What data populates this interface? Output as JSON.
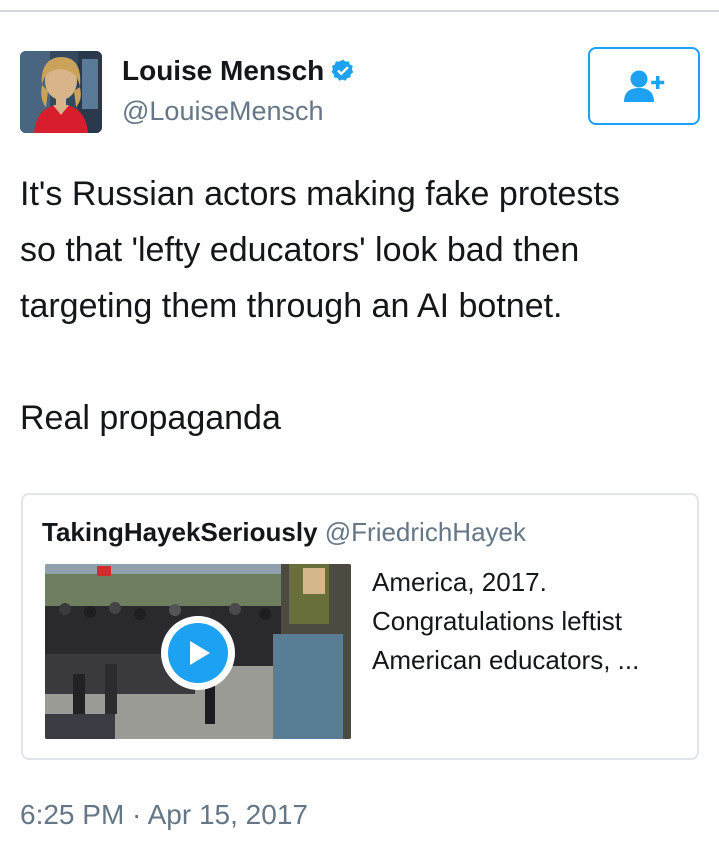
{
  "author": {
    "display_name": "Louise Mensch",
    "handle": "@LouiseMensch",
    "verified": true,
    "avatar_icon": "profile-photo"
  },
  "follow_button": {
    "icon": "add-user-icon",
    "color": "#1da1f2"
  },
  "tweet": {
    "text": "It's Russian actors making fake protests\nso that 'lefty educators' look bad then\ntargeting them through an AI botnet.\n\nReal propaganda",
    "timestamp": "6:25 PM · Apr 15, 2017"
  },
  "quoted_tweet": {
    "display_name": "TakingHayekSeriously",
    "handle": "@FriedrichHayek",
    "text": "America, 2017.\nCongratulations leftist\nAmerican educators, ...",
    "media": {
      "type": "video",
      "play_icon": "play-icon"
    }
  },
  "colors": {
    "accent": "#1da1f2",
    "text": "#14171a",
    "secondary_text": "#657786",
    "border": "#dfe5ea"
  }
}
